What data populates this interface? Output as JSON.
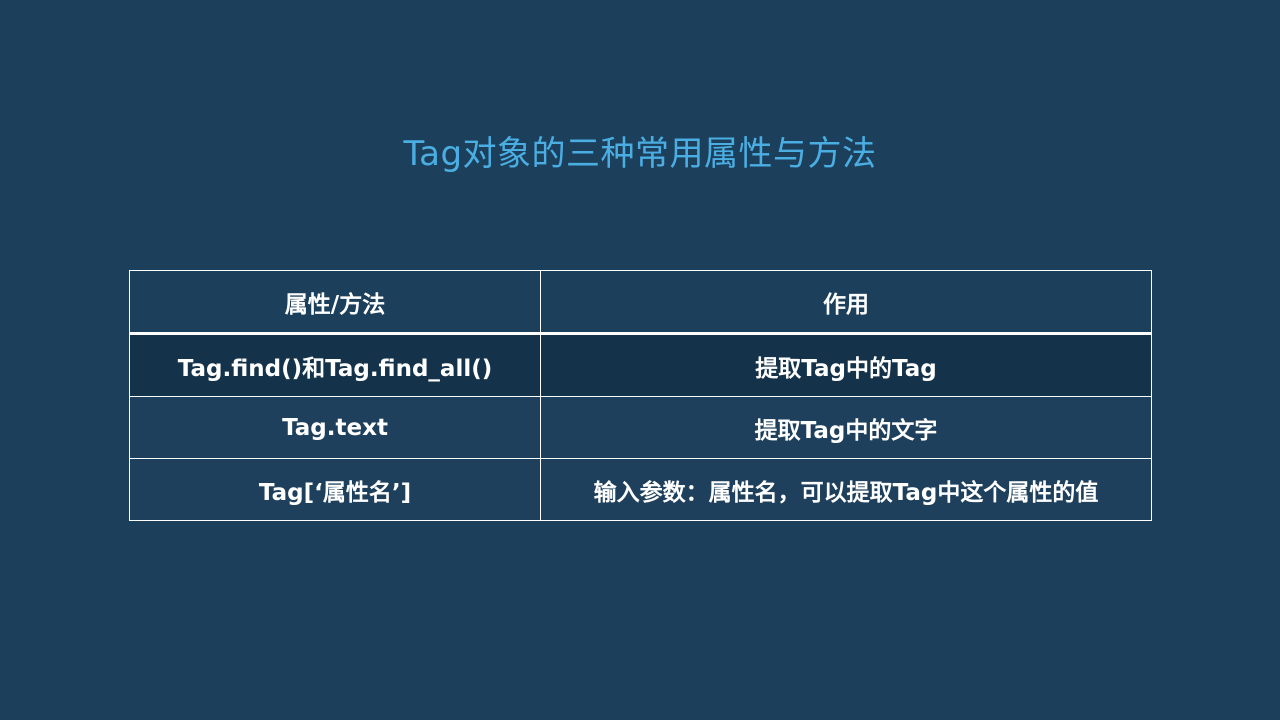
{
  "slide": {
    "title": "Tag对象的三种常用属性与方法"
  },
  "table": {
    "headers": [
      "属性/方法",
      "作用"
    ],
    "rows": [
      [
        "Tag.find()和Tag.find_all()",
        "提取Tag中的Tag"
      ],
      [
        "Tag.text",
        "提取Tag中的文字"
      ],
      [
        "Tag[‘属性名’]",
        "输入参数：属性名，可以提取Tag中这个属性的值"
      ]
    ]
  },
  "colors": {
    "background": "#1c3f5b",
    "title": "#4aaee3",
    "highlight_row": "#14324a",
    "table_text": "#ffffff",
    "table_border": "#ffffff"
  }
}
